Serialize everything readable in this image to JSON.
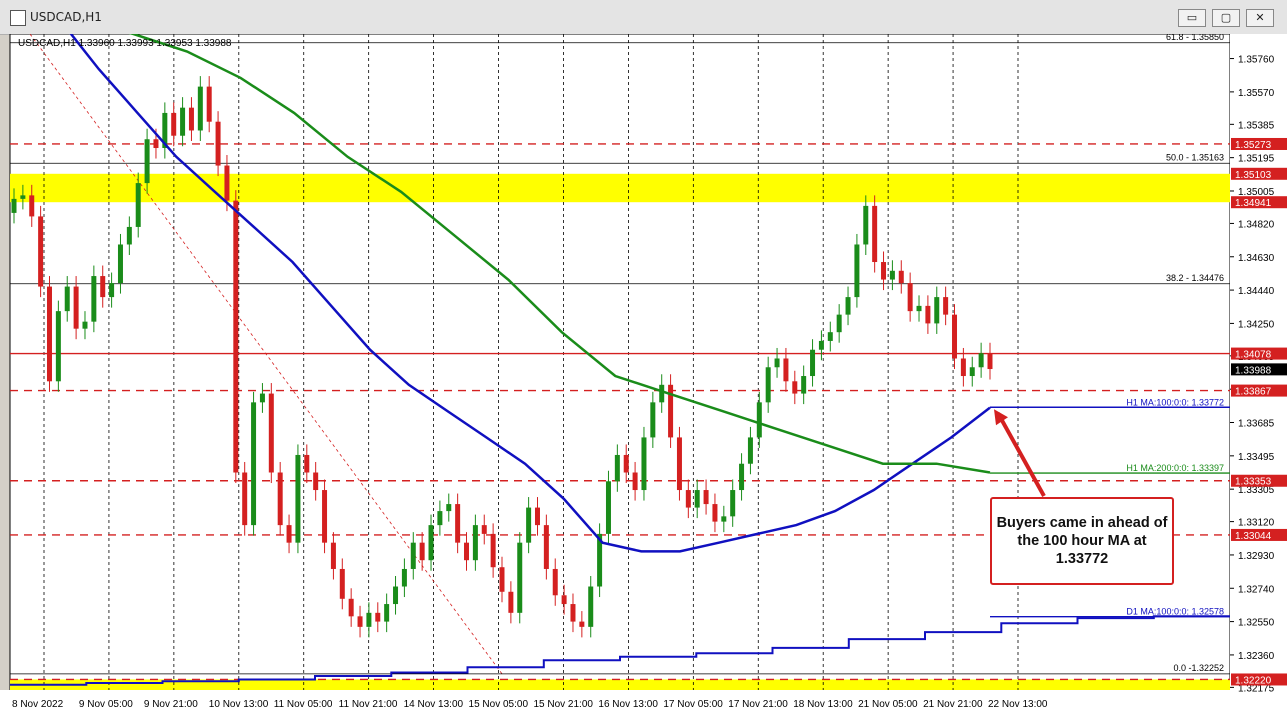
{
  "window": {
    "title": "USDCAD,H1",
    "buttons": {
      "minimize": "▭",
      "restore": "▢",
      "close": "✕"
    }
  },
  "chart_data": {
    "type": "candlestick",
    "symbol_header": "USDCAD,H1  1.33960 1.33993 1.33953 1.33988",
    "ylim": [
      1.3216,
      1.359
    ],
    "y_ticks": [
      "1.35760",
      "1.35570",
      "1.35385",
      "1.35195",
      "1.35005",
      "1.34820",
      "1.34630",
      "1.34440",
      "1.34250",
      "1.34065",
      "1.33875",
      "1.33685",
      "1.33495",
      "1.33305",
      "1.33120",
      "1.32930",
      "1.32740",
      "1.32550",
      "1.32360",
      "1.32175"
    ],
    "x_ticks": [
      "8 Nov 2022",
      "9 Nov 05:00",
      "9 Nov 21:00",
      "10 Nov 13:00",
      "11 Nov 05:00",
      "11 Nov 21:00",
      "14 Nov 13:00",
      "15 Nov 05:00",
      "15 Nov 21:00",
      "16 Nov 13:00",
      "17 Nov 05:00",
      "17 Nov 21:00",
      "18 Nov 13:00",
      "21 Nov 05:00",
      "21 Nov 21:00",
      "22 Nov 13:00"
    ],
    "ohlc_close_path": [
      1.3496,
      1.3498,
      1.3486,
      1.3446,
      1.3392,
      1.3432,
      1.3446,
      1.3422,
      1.3426,
      1.3452,
      1.344,
      1.3448,
      1.347,
      1.348,
      1.3505,
      1.353,
      1.3525,
      1.3545,
      1.3532,
      1.3548,
      1.3535,
      1.356,
      1.354,
      1.3515,
      1.3495,
      1.334,
      1.331,
      1.338,
      1.3385,
      1.334,
      1.331,
      1.33,
      1.335,
      1.334,
      1.333,
      1.33,
      1.3285,
      1.3268,
      1.3258,
      1.3252,
      1.326,
      1.3255,
      1.3265,
      1.3275,
      1.3285,
      1.33,
      1.329,
      1.331,
      1.3318,
      1.3322,
      1.33,
      1.329,
      1.331,
      1.3305,
      1.3286,
      1.3272,
      1.326,
      1.33,
      1.332,
      1.331,
      1.3285,
      1.327,
      1.3265,
      1.3255,
      1.3252,
      1.3275,
      1.3305,
      1.3335,
      1.335,
      1.334,
      1.333,
      1.336,
      1.338,
      1.339,
      1.336,
      1.333,
      1.332,
      1.333,
      1.3322,
      1.3312,
      1.3315,
      1.333,
      1.3345,
      1.336,
      1.338,
      1.34,
      1.3405,
      1.3392,
      1.3385,
      1.3395,
      1.341,
      1.3415,
      1.342,
      1.343,
      1.344,
      1.347,
      1.3492,
      1.346,
      1.345,
      1.3455,
      1.3448,
      1.3432,
      1.3435,
      1.3425,
      1.344,
      1.343,
      1.3405,
      1.3395,
      1.34,
      1.3408,
      1.3399
    ],
    "horizontal_levels": [
      {
        "value": 1.3585,
        "label": "61.8 - 1.35850",
        "color": "#000000",
        "style": "solid"
      },
      {
        "value": 1.35163,
        "label": "50.0 - 1.35163",
        "color": "#000000",
        "style": "solid"
      },
      {
        "value": 1.34476,
        "label": "38.2 - 1.34476",
        "color": "#000000",
        "style": "solid"
      },
      {
        "value": 1.32252,
        "label": "0.0 -1.32252",
        "color": "#000000",
        "style": "solid"
      },
      {
        "value": 1.35273,
        "label": "1.35273",
        "color": "#d42020",
        "style": "dashed"
      },
      {
        "value": 1.34078,
        "label": "1.34078",
        "color": "#d42020",
        "style": "solid"
      },
      {
        "value": 1.33867,
        "label": "1.33867",
        "color": "#d42020",
        "style": "dashed"
      },
      {
        "value": 1.33353,
        "label": "1.33353",
        "color": "#d42020",
        "style": "dashed"
      },
      {
        "value": 1.33044,
        "label": "1.33044",
        "color": "#d42020",
        "style": "dashed"
      },
      {
        "value": 1.3222,
        "label": "1.32220",
        "color": "#d42020",
        "style": "dashed"
      }
    ],
    "zones": [
      {
        "from": 1.34941,
        "to": 1.35103,
        "color": "#ffff00",
        "labels": [
          "1.35103",
          "1.34941"
        ]
      },
      {
        "from": 1.3216,
        "to": 1.3222,
        "color": "#ffff00",
        "labels": []
      }
    ],
    "price_tag": {
      "value": 1.33988,
      "label": "1.33988"
    },
    "moving_averages": [
      {
        "name": "H1 MA:100:0:0: 1.33772",
        "color": "#1010c0",
        "last": 1.33772
      },
      {
        "name": "H1 MA:200:0:0: 1.33397",
        "color": "#1a8c1a",
        "last": 1.33397
      },
      {
        "name": "D1 MA:100:0:0: 1.32578",
        "color": "#1010c0",
        "last": 1.32578
      }
    ],
    "ma100_path": [
      1.3598,
      1.357,
      1.3545,
      1.352,
      1.35,
      1.348,
      1.346,
      1.3435,
      1.341,
      1.339,
      1.3375,
      1.336,
      1.3345,
      1.3325,
      1.33,
      1.3295,
      1.3295,
      1.33,
      1.3305,
      1.331,
      1.3318,
      1.333,
      1.3345,
      1.336,
      1.3377
    ],
    "ma200_path": [
      1.3598,
      1.359,
      1.358,
      1.3565,
      1.3545,
      1.352,
      1.35,
      1.3475,
      1.345,
      1.342,
      1.3395,
      1.3385,
      1.3375,
      1.3365,
      1.3355,
      1.3345,
      1.3345,
      1.334
    ],
    "d1ma_steps": [
      1.3219,
      1.322,
      1.3221,
      1.3222,
      1.3224,
      1.3226,
      1.3229,
      1.3233,
      1.3235,
      1.3237,
      1.324,
      1.3245,
      1.3249,
      1.3254,
      1.3257,
      1.3258
    ]
  },
  "annotation": {
    "text": "Buyers came in ahead of the 100 hour MA at 1.33772"
  }
}
